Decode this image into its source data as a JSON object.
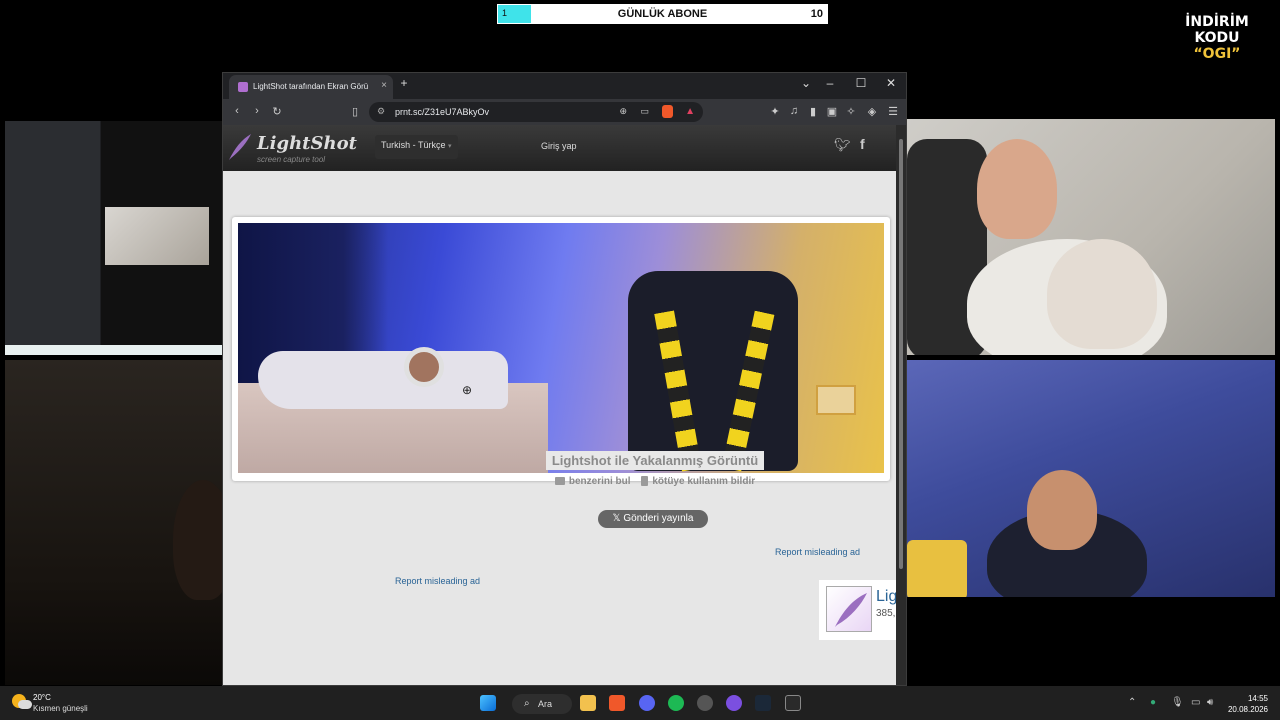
{
  "overlay": {
    "sub_bar": {
      "label": "GÜNLÜK ABONE",
      "current": "1",
      "goal": "10",
      "progress_fraction": 0.1
    },
    "promo": {
      "line1": "İNDİRİM KODU",
      "line2": "“OGI”"
    }
  },
  "browser": {
    "tab_title": "LightShot tarafından Ekran Görü",
    "tab_close": "×",
    "new_tab": "+",
    "window_controls": {
      "dropdown": "⌄",
      "minimize": "–",
      "maximize": "☐",
      "close": "✕"
    },
    "url": "prnt.sc/Z31eU7ABkyOv"
  },
  "lightshot": {
    "logo_text": "LightShot",
    "logo_sub": "screen capture tool",
    "language": "Turkish - Türkçe",
    "login": "Giriş yap",
    "shot_title": "Lightshot ile Yakalanmış Görüntü",
    "find_similar": "benzerini bul",
    "report_abuse": "kötüye kullanım bildir",
    "post_button": "Gönderi yayınla",
    "report_ad_1": "Report misleading ad",
    "report_ad_2": "Report misleading ad",
    "promo_card_title": "Lig",
    "promo_card_sub": "385,"
  },
  "taskbar": {
    "temperature": "20°C",
    "weather_desc": "Kısmen güneşli",
    "search": "Ara",
    "time": "14:55",
    "date": "20.08.2026"
  }
}
